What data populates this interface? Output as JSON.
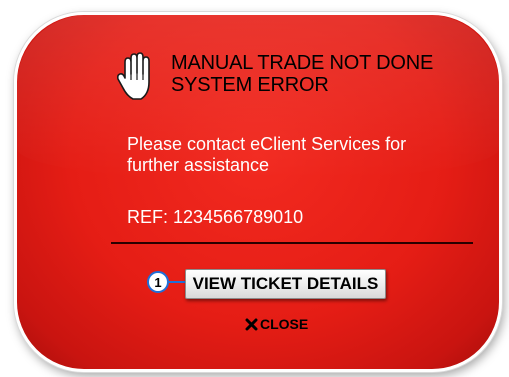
{
  "dialog": {
    "title_line1": "MANUAL TRADE NOT DONE",
    "title_line2": "SYSTEM ERROR",
    "icon": "stop-hand-icon",
    "message": "Please contact eClient Services for further assistance",
    "ref": "REF: 1234566789010",
    "step_number": "1",
    "view_button_label": "VIEW TICKET DETAILS",
    "close_label": "CLOSE",
    "close_icon": "close-icon",
    "colors": {
      "background": "#e51d15",
      "title_text": "#000000",
      "message_text": "#ffffff",
      "badge_border": "#1f6fd8"
    }
  }
}
